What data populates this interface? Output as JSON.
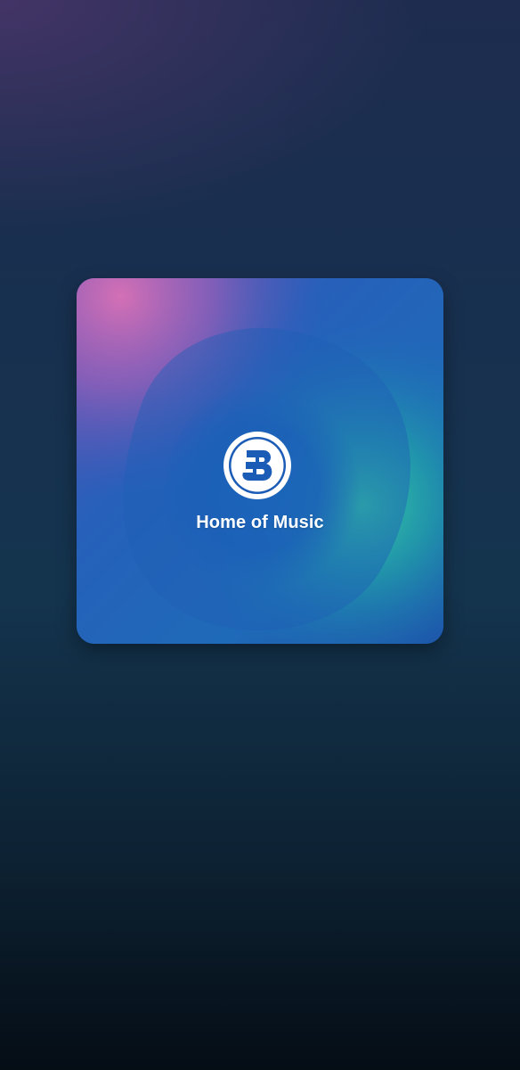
{
  "splash": {
    "title": "Home of Music",
    "logo_icon": "b-logo-icon"
  },
  "colors": {
    "card_blue": "#1b5cb6",
    "card_pink": "#c36bb3",
    "card_teal": "#2fc29f",
    "text": "#ffffff"
  }
}
